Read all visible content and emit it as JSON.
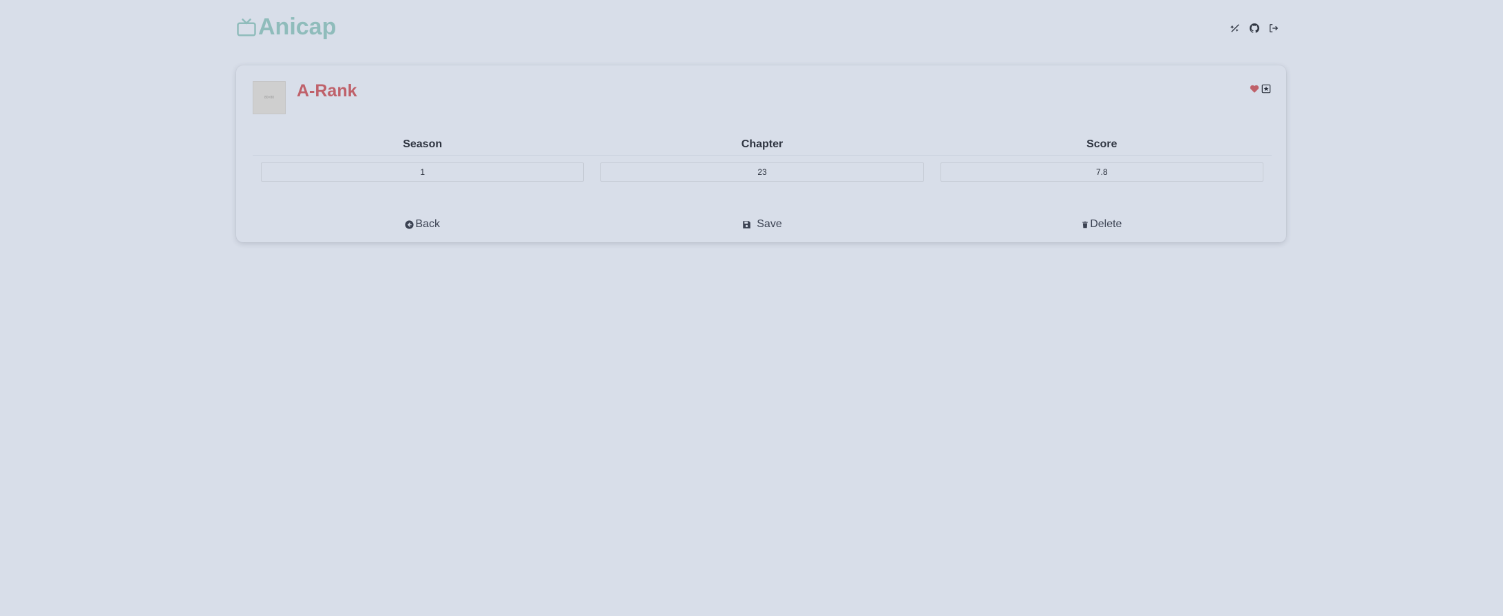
{
  "app": {
    "name": "Anicap",
    "brand_color": "#8fbcbb"
  },
  "header": {
    "icons": [
      "theme-toggle-icon",
      "github-icon",
      "logout-icon"
    ]
  },
  "card": {
    "title": "A-Rank",
    "title_color": "#bf616a",
    "thumbnail_text": "80×80",
    "icons": [
      "heart-icon",
      "star-box-icon"
    ]
  },
  "table": {
    "headers": [
      "Season",
      "Chapter",
      "Score"
    ],
    "values": [
      "1",
      "23",
      "7.8"
    ]
  },
  "actions": {
    "back_label": "Back",
    "save_label": "Save",
    "delete_label": "Delete"
  }
}
